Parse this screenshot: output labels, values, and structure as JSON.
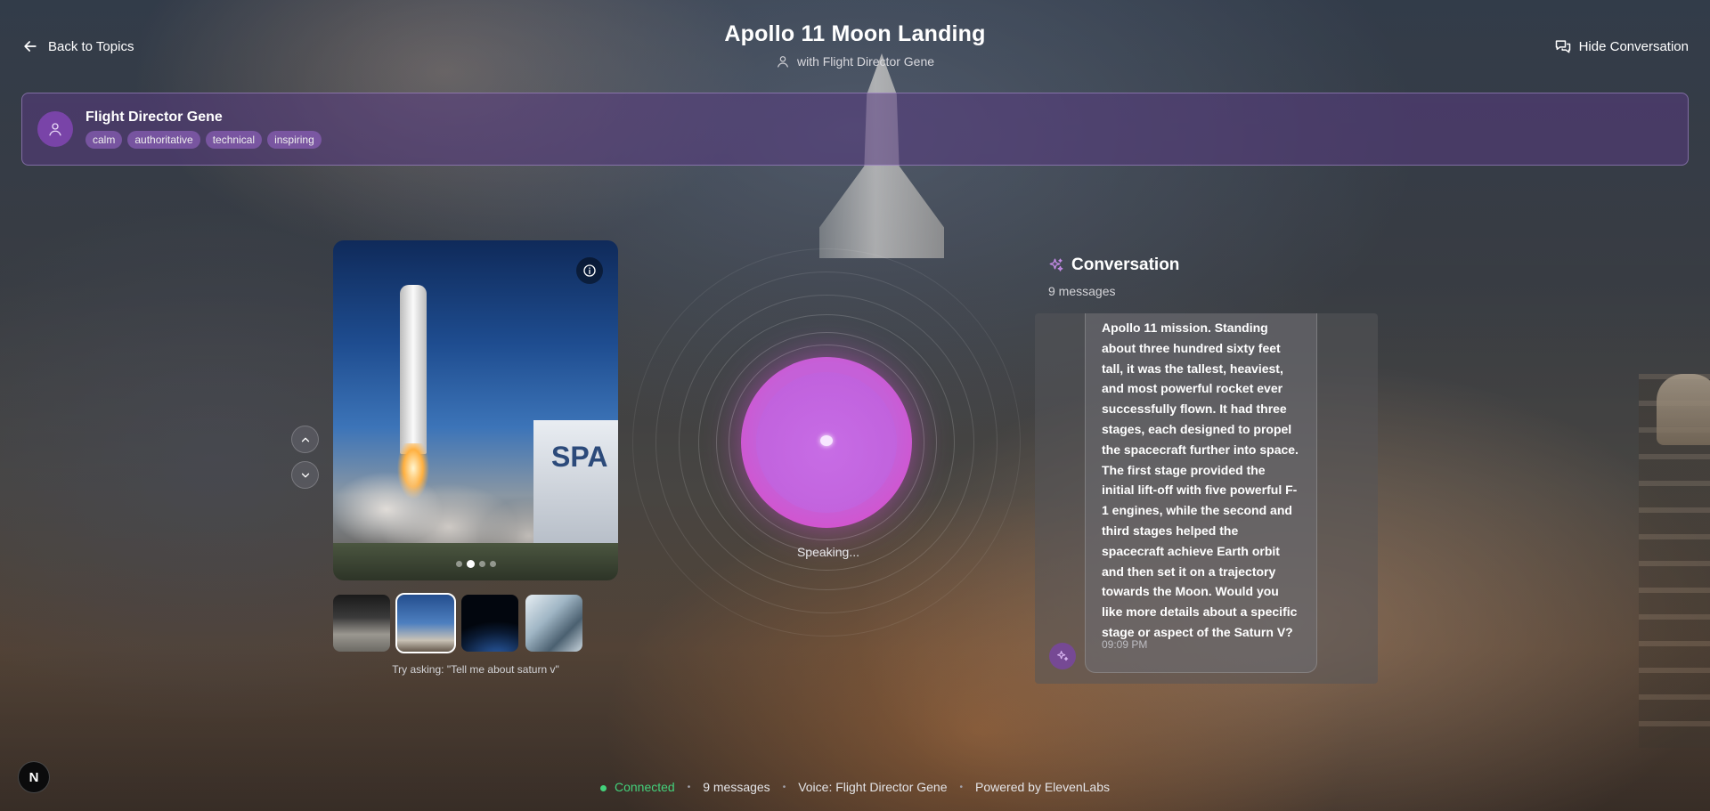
{
  "header": {
    "back_label": "Back to Topics",
    "title": "Apollo 11 Moon Landing",
    "subtitle": "with Flight Director Gene",
    "hide_label": "Hide Conversation"
  },
  "persona": {
    "name": "Flight Director Gene",
    "tags": [
      "calm",
      "authoritative",
      "technical",
      "inspiring"
    ]
  },
  "media": {
    "building_text": "SPA",
    "slides_total": 4,
    "slide_active": 2,
    "try_asking": "Try asking: \"Tell me about saturn v\""
  },
  "voice": {
    "status": "Speaking..."
  },
  "conversation": {
    "title": "Conversation",
    "count": "9 messages",
    "message": "Apollo 11 mission. Standing about three hundred sixty feet tall, it was the tallest, heaviest, and most powerful rocket ever successfully flown. It had three stages, each designed to propel the spacecraft further into space. The first stage provided the initial lift-off with five powerful F-1 engines, while the second and third stages helped the spacecraft achieve Earth orbit and then set it on a trajectory towards the Moon. Would you like more details about a specific stage or aspect of the Saturn V?",
    "time": "09:09 PM"
  },
  "footer": {
    "badge": "N",
    "status": "Connected",
    "messages": "9 messages",
    "voice": "Voice: Flight Director Gene",
    "powered": "Powered by ElevenLabs",
    "separator": "•"
  },
  "colors": {
    "accent": "#c560d8",
    "orb_edge": "#e246c4",
    "status_green": "#43d17b",
    "persona_bg": "#583a80"
  },
  "icons": {
    "back": "arrow-left-icon",
    "user": "user-icon",
    "hide": "chat-bubbles-icon",
    "info": "info-icon",
    "up": "chevron-up-icon",
    "down": "chevron-down-icon",
    "sparkle": "sparkles-icon"
  }
}
